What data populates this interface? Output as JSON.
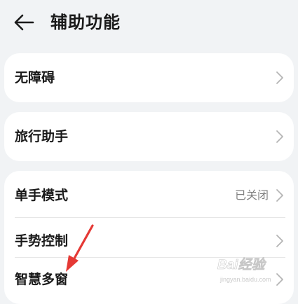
{
  "header": {
    "back_icon": "back-arrow-icon",
    "title": "辅助功能"
  },
  "sections": [
    {
      "items": [
        {
          "label": "无障碍",
          "icon": "chevron-right-icon"
        }
      ]
    },
    {
      "items": [
        {
          "label": "旅行助手",
          "icon": "chevron-right-icon"
        }
      ]
    },
    {
      "items": [
        {
          "label": "单手模式",
          "status": "已关闭",
          "icon": "chevron-right-icon"
        },
        {
          "label": "手势控制",
          "icon": "chevron-right-icon"
        },
        {
          "label": "智慧多窗",
          "icon": "chevron-right-icon"
        }
      ]
    }
  ],
  "annotation": {
    "arrow_color": "#e53935"
  },
  "watermark": {
    "main": "Bai经验",
    "sub": "jingyan.baidu.com"
  },
  "colors": {
    "background": "#f1f3f5",
    "card": "#ffffff",
    "text": "#1a1a1a",
    "status_text": "#808080"
  }
}
